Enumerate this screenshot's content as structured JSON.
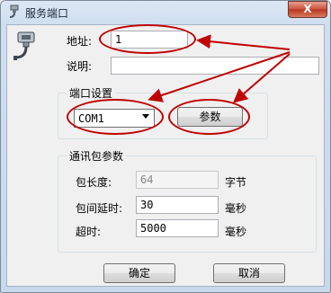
{
  "window": {
    "title": "服务端口",
    "close_glyph": "X"
  },
  "form": {
    "address_label": "地址:",
    "address_value": "1",
    "desc_label": "说明:",
    "desc_value": ""
  },
  "port_settings": {
    "group_title": "端口设置",
    "port_value": "COM1",
    "params_button": "参数"
  },
  "packet_params": {
    "group_title": "通讯包参数",
    "length_label": "包长度:",
    "length_value": "64",
    "length_unit": "字节",
    "delay_label": "包间延时:",
    "delay_value": "30",
    "delay_unit": "毫秒",
    "timeout_label": "超时:",
    "timeout_value": "5000",
    "timeout_unit": "毫秒"
  },
  "buttons": {
    "ok": "确定",
    "cancel": "取消"
  },
  "colors": {
    "annotation": "#c00000"
  }
}
